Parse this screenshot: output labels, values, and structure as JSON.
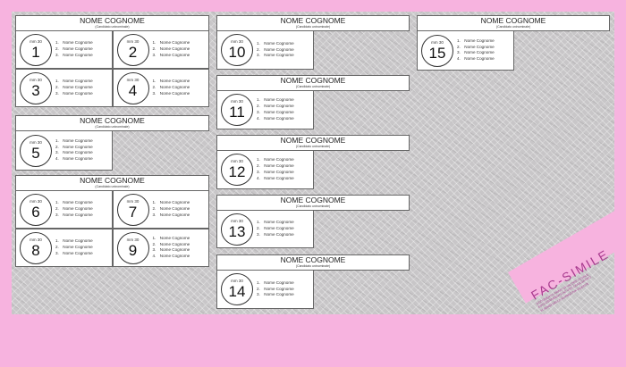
{
  "colors": {
    "background": "#f7b3df",
    "sheet": "#c8c6c8",
    "stamp": "#a83a8e"
  },
  "stamp": {
    "title": "FAC-SIMILE",
    "lines": [
      "DOCUMENTO PRIVO DI VALORE LEGALE",
      "ESCLUSIVAMENTE AD USO DIVULGATIVO",
      "AI SENSI DELLA NORMATIVA VIGENTE"
    ]
  },
  "groups": [
    {
      "title": "NOME COGNOME",
      "subtitle": "(Candidato uninominale)",
      "candidates": [
        {
          "mm": "mm 30",
          "number": "1",
          "names": [
            "Nome Cognome",
            "Nome Cognome",
            "Nome Cognome"
          ]
        },
        {
          "mm": "mm 30",
          "number": "2",
          "names": [
            "Nome Cognome",
            "Nome Cognome",
            "Nome Cognome"
          ]
        },
        {
          "mm": "mm 30",
          "number": "3",
          "names": [
            "Nome Cognome",
            "Nome Cognome",
            "Nome Cognome"
          ]
        },
        {
          "mm": "mm 30",
          "number": "4",
          "names": [
            "Nome Cognome",
            "Nome Cognome",
            "Nome Cognome"
          ]
        }
      ]
    },
    {
      "title": "NOME COGNOME",
      "subtitle": "(Candidato uninominale)",
      "candidates": [
        {
          "mm": "mm 30",
          "number": "5",
          "names": [
            "Nome Cognome",
            "Nome Cognome",
            "Nome Cognome",
            "Nome Cognome"
          ]
        }
      ]
    },
    {
      "title": "NOME COGNOME",
      "subtitle": "(Candidato uninominale)",
      "candidates": [
        {
          "mm": "mm 30",
          "number": "6",
          "names": [
            "Nome Cognome",
            "Nome Cognome",
            "Nome Cognome"
          ]
        },
        {
          "mm": "mm 30",
          "number": "7",
          "names": [
            "Nome Cognome",
            "Nome Cognome",
            "Nome Cognome"
          ]
        },
        {
          "mm": "mm 30",
          "number": "8",
          "names": [
            "Nome Cognome",
            "Nome Cognome",
            "Nome Cognome"
          ]
        },
        {
          "mm": "mm 30",
          "number": "9",
          "names": [
            "Nome Cognome",
            "Nome Cognome",
            "Nome Cognome",
            "Nome Cognome"
          ]
        }
      ]
    },
    {
      "title": "NOME COGNOME",
      "subtitle": "(Candidato uninominale)",
      "candidates": [
        {
          "mm": "mm 30",
          "number": "10",
          "names": [
            "Nome Cognome",
            "Nome Cognome",
            "Nome Cognome"
          ]
        }
      ]
    },
    {
      "title": "NOME COGNOME",
      "subtitle": "(Candidato uninominale)",
      "candidates": [
        {
          "mm": "mm 30",
          "number": "11",
          "names": [
            "Nome Cognome",
            "Nome Cognome",
            "Nome Cognome",
            "Nome Cognome"
          ]
        }
      ]
    },
    {
      "title": "NOME COGNOME",
      "subtitle": "(Candidato uninominale)",
      "candidates": [
        {
          "mm": "mm 30",
          "number": "12",
          "names": [
            "Nome Cognome",
            "Nome Cognome",
            "Nome Cognome",
            "Nome Cognome"
          ]
        }
      ]
    },
    {
      "title": "NOME COGNOME",
      "subtitle": "(Candidato uninominale)",
      "candidates": [
        {
          "mm": "mm 30",
          "number": "13",
          "names": [
            "Nome Cognome",
            "Nome Cognome",
            "Nome Cognome"
          ]
        }
      ]
    },
    {
      "title": "NOME COGNOME",
      "subtitle": "(Candidato uninominale)",
      "candidates": [
        {
          "mm": "mm 30",
          "number": "14",
          "names": [
            "Nome Cognome",
            "Nome Cognome",
            "Nome Cognome"
          ]
        }
      ]
    },
    {
      "title": "NOME COGNOME",
      "subtitle": "(Candidato uninominale)",
      "candidates": [
        {
          "mm": "mm 30",
          "number": "15",
          "names": [
            "Nome Cognome",
            "Nome Cognome",
            "Nome Cognome",
            "Nome Cognome"
          ]
        }
      ]
    }
  ]
}
